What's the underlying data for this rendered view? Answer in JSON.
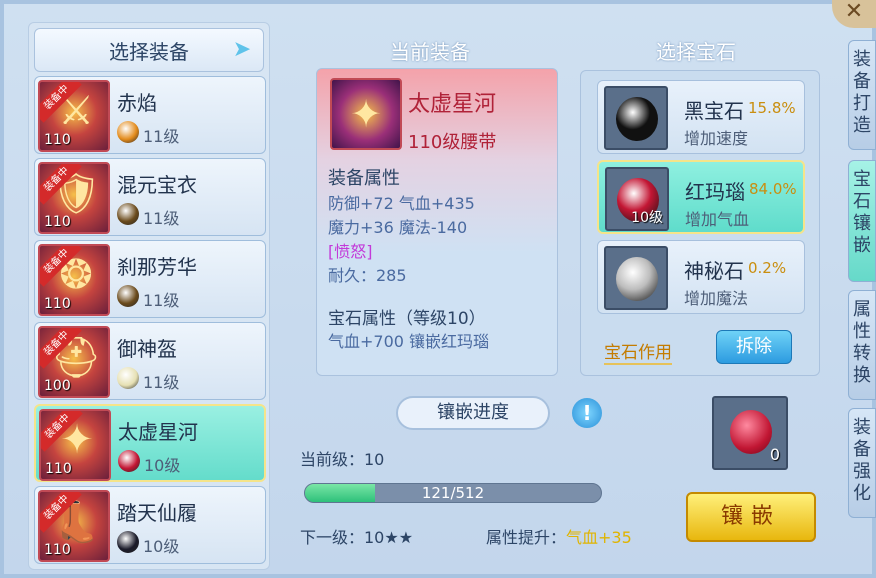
{
  "left": {
    "title": "选择装备",
    "items": [
      {
        "name": "赤焰",
        "level": "110",
        "badge": "装备中",
        "gem_level": "11级",
        "gem_color": "#e38b1c",
        "glyph": "⚔"
      },
      {
        "name": "混元宝衣",
        "level": "110",
        "badge": "装备中",
        "gem_level": "11级",
        "gem_color": "#6b4b1c",
        "glyph": "🛡"
      },
      {
        "name": "刹那芳华",
        "level": "110",
        "badge": "装备中",
        "gem_level": "11级",
        "gem_color": "#6b4b1c",
        "glyph": "❂"
      },
      {
        "name": "御神盔",
        "level": "100",
        "badge": "装备中",
        "gem_level": "11级",
        "gem_color": "#e6e0b3",
        "glyph": "⛑"
      },
      {
        "name": "太虚星河",
        "level": "110",
        "badge": "装备中",
        "gem_level": "10级",
        "gem_color": "#c31634",
        "glyph": "✦"
      },
      {
        "name": "踏天仙履",
        "level": "110",
        "badge": "装备中",
        "gem_level": "10级",
        "gem_color": "#1b1b2a",
        "glyph": "👢"
      }
    ],
    "selected_index": 4
  },
  "middle": {
    "title": "当前装备",
    "item_name": "太虚星河",
    "item_type": "110级腰带",
    "attr_head": "装备属性",
    "lines": [
      "防御+72 气血+435",
      "魔力+36 魔法-140",
      "[愤怒]",
      "耐久：285"
    ],
    "gem_head": "宝石属性（等级10）",
    "gem_line": "气血+700 镶嵌红玛瑙",
    "icon_glyph": "✦"
  },
  "right": {
    "title": "选择宝石",
    "gems": [
      {
        "name": "黑宝石",
        "rate": "15.8%",
        "effect": "增加速度",
        "slot_level": "",
        "color": "#111"
      },
      {
        "name": "红玛瑙",
        "rate": "84.0%",
        "effect": "增加气血",
        "slot_level": "10级",
        "color": "#c31634"
      },
      {
        "name": "神秘石",
        "rate": "0.2%",
        "effect": "增加魔法",
        "slot_level": "",
        "color": "#bdbdbd"
      }
    ],
    "gem_func": "宝石作用",
    "remove_label": "拆除"
  },
  "progress": {
    "title": "镶嵌进度",
    "info_glyph": "!",
    "current_level": "当前级：10",
    "value": 121,
    "max": 512,
    "text": "121/512",
    "next_level": "下一级：10★★",
    "attr_up_label": "属性提升：",
    "attr_up_value": "气血+35"
  },
  "inlay": {
    "count": "0",
    "button": "镶嵌"
  },
  "side_tabs": [
    "装备打造",
    "宝石镶嵌",
    "属性转换",
    "装备强化"
  ],
  "close": "✕"
}
